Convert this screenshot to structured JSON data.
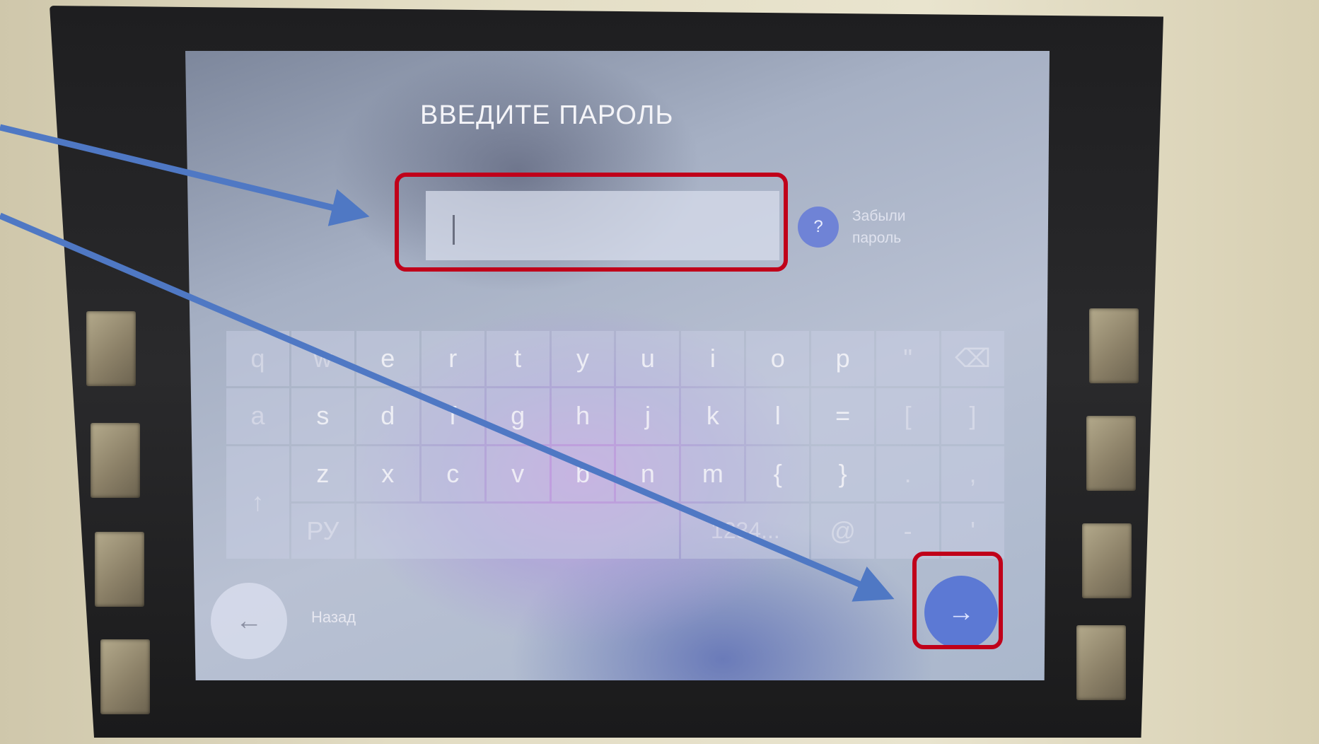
{
  "screen": {
    "title": "ВВЕДИТЕ ПАРОЛЬ",
    "password_input": {
      "value": "",
      "placeholder": ""
    },
    "forgot": {
      "icon": "question-icon",
      "icon_text": "?",
      "lines": [
        "Забыли",
        "пароль"
      ]
    },
    "keyboard": {
      "rows": [
        [
          "q",
          "w",
          "e",
          "r",
          "t",
          "y",
          "u",
          "i",
          "o",
          "p",
          "\"",
          "⌫"
        ],
        [
          "a",
          "s",
          "d",
          "f",
          "g",
          "h",
          "j",
          "k",
          "l",
          "=",
          "[",
          "]"
        ],
        [
          "↑",
          "z",
          "x",
          "c",
          "v",
          "b",
          "n",
          "m",
          "{",
          "}",
          ".",
          ","
        ],
        [
          "РУ",
          "",
          "1234...",
          "@",
          "-",
          "'"
        ]
      ]
    },
    "back": {
      "icon": "arrow-left-icon",
      "icon_text": "←",
      "label": "Назад"
    },
    "next": {
      "icon": "arrow-right-icon",
      "icon_text": "→"
    }
  },
  "annotations": {
    "highlight_color": "#c0001a",
    "arrow_color": "#4f78c4"
  }
}
